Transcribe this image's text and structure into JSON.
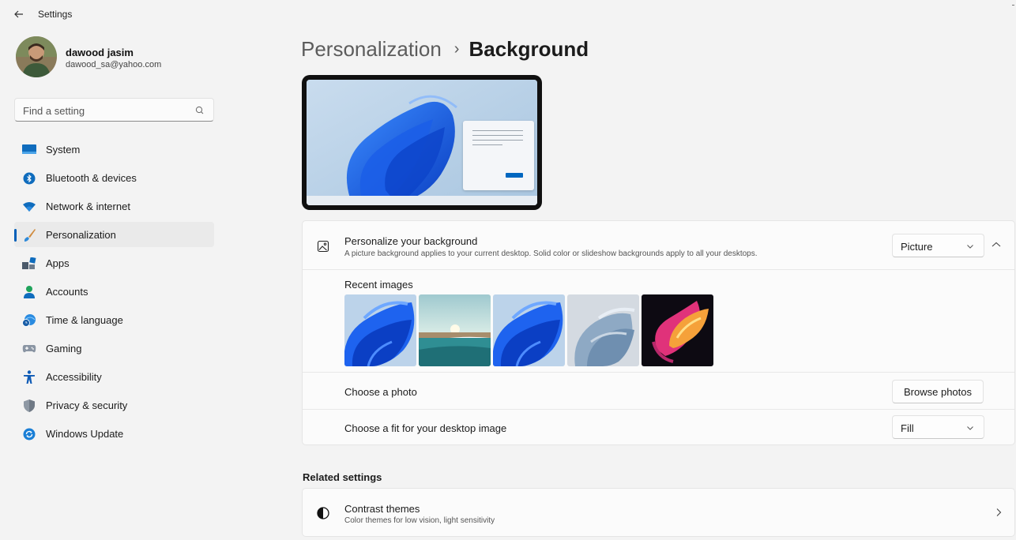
{
  "app": {
    "title": "Settings"
  },
  "profile": {
    "name": "dawood jasim",
    "email": "dawood_sa@yahoo.com"
  },
  "search": {
    "placeholder": "Find a setting",
    "value": ""
  },
  "sidebar": {
    "items": [
      {
        "label": "System",
        "icon": "system-icon"
      },
      {
        "label": "Bluetooth & devices",
        "icon": "bluetooth-icon"
      },
      {
        "label": "Network & internet",
        "icon": "wifi-icon"
      },
      {
        "label": "Personalization",
        "icon": "brush-icon",
        "active": true
      },
      {
        "label": "Apps",
        "icon": "apps-icon"
      },
      {
        "label": "Accounts",
        "icon": "person-icon"
      },
      {
        "label": "Time & language",
        "icon": "globe-clock-icon"
      },
      {
        "label": "Gaming",
        "icon": "gamepad-icon"
      },
      {
        "label": "Accessibility",
        "icon": "accessibility-icon"
      },
      {
        "label": "Privacy & security",
        "icon": "shield-icon"
      },
      {
        "label": "Windows Update",
        "icon": "update-icon"
      }
    ]
  },
  "breadcrumb": {
    "parent": "Personalization",
    "separator": "›",
    "current": "Background"
  },
  "background": {
    "title": "Personalize your background",
    "description": "A picture background applies to your current desktop. Solid color or slideshow backgrounds apply to all your desktops.",
    "type_value": "Picture",
    "recent_label": "Recent images",
    "recent_images": [
      "windows-bloom-blue",
      "lake-sunrise",
      "windows-bloom-blue",
      "silver-bloom",
      "colorful-bloom-dark"
    ],
    "choose_photo_label": "Choose a photo",
    "browse_button": "Browse photos",
    "fit_label": "Choose a fit for your desktop image",
    "fit_value": "Fill"
  },
  "related": {
    "title": "Related settings",
    "contrast": {
      "title": "Contrast themes",
      "description": "Color themes for low vision, light sensitivity"
    }
  },
  "colors": {
    "accent": "#005fb8",
    "card": "#fbfbfb",
    "background": "#f3f3f3"
  }
}
